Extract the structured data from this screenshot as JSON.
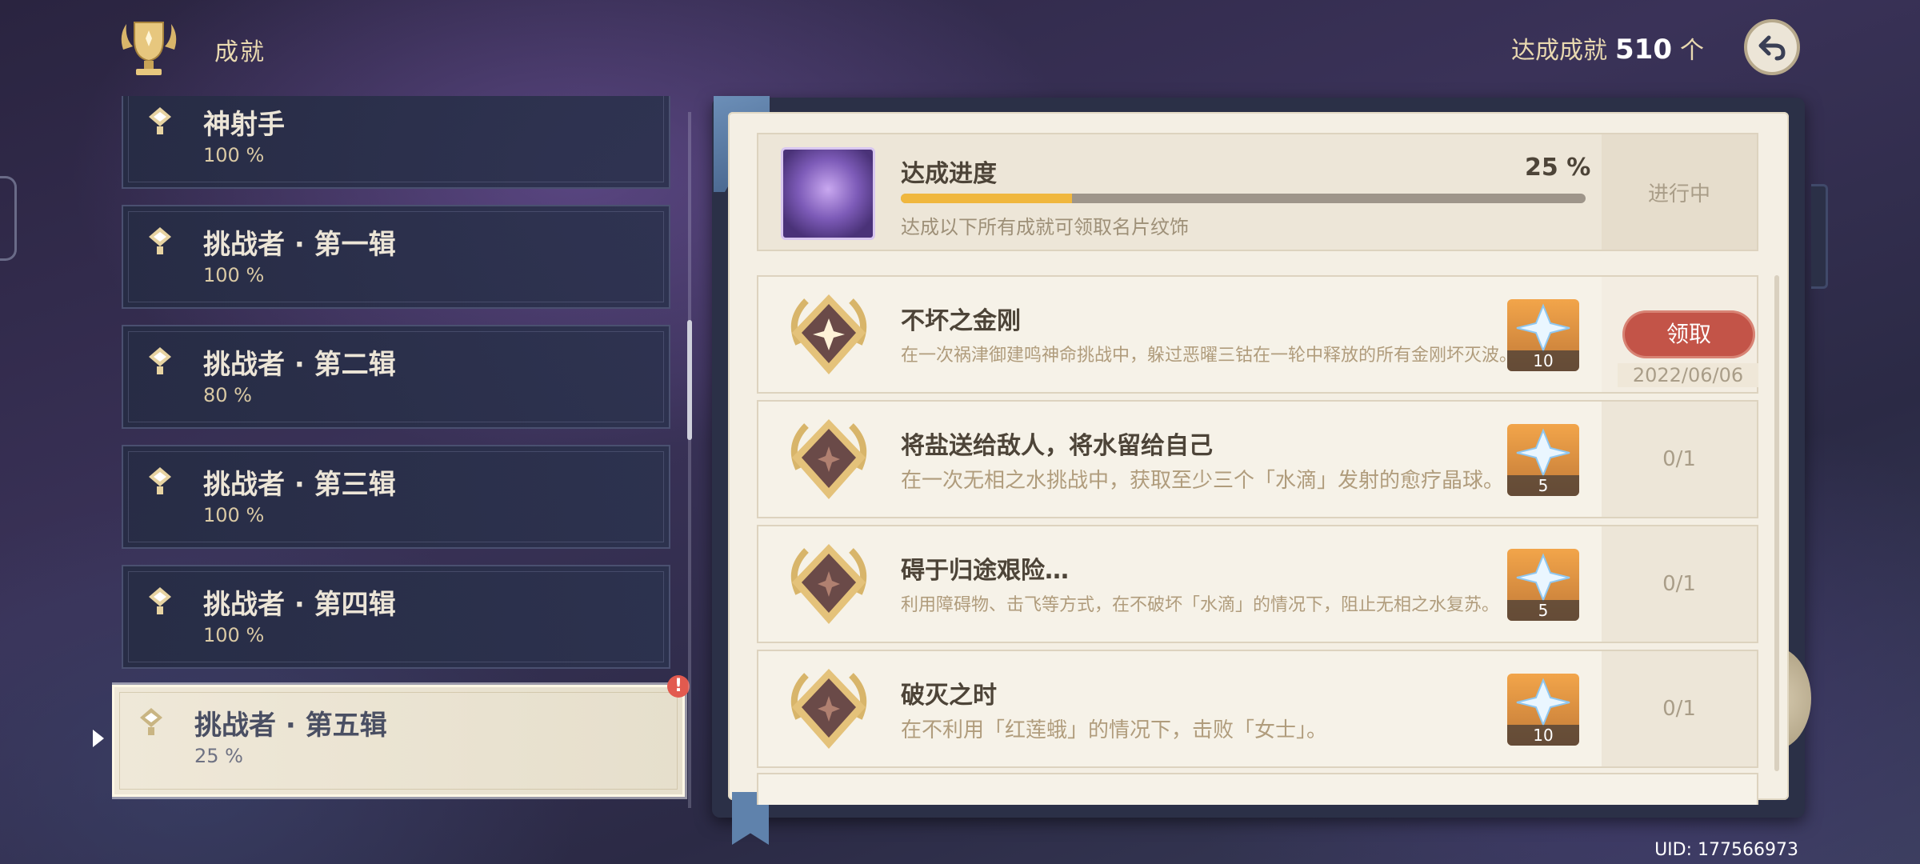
{
  "header": {
    "title": "成就",
    "achieved_label": "达成成就",
    "achieved_count": "510",
    "achieved_unit": "个"
  },
  "categories": [
    {
      "name": "神射手",
      "percent": "100 %"
    },
    {
      "name": "挑战者 · 第一辑",
      "percent": "100 %"
    },
    {
      "name": "挑战者 · 第二辑",
      "percent": "80 %"
    },
    {
      "name": "挑战者 · 第三辑",
      "percent": "100 %"
    },
    {
      "name": "挑战者 · 第四辑",
      "percent": "100 %"
    },
    {
      "name": "挑战者 · 第五辑",
      "percent": "25 %",
      "selected": true
    }
  ],
  "notification_badge": "!",
  "progress": {
    "title": "达成进度",
    "percent_text": "25 %",
    "percent_value": 25,
    "description": "达成以下所有成就可领取名片纹饰",
    "status": "进行中"
  },
  "achievements": [
    {
      "title": "不坏之金刚",
      "description": "在一次祸津御建鸣神命挑战中，躲过恶曜三钴在一轮中释放的所有金刚坏灭波。",
      "reward_count": "10",
      "claim_label": "领取",
      "date": "2022/06/06"
    },
    {
      "title": "将盐送给敌人，将水留给自己",
      "description": "在一次无相之水挑战中，获取至少三个「水滴」发射的愈疗晶球。",
      "reward_count": "5",
      "progress": "0/1"
    },
    {
      "title": "碍于归途艰险…",
      "description": "利用障碍物、击飞等方式，在不破坏「水滴」的情况下，阻止无相之水复苏。",
      "reward_count": "5",
      "progress": "0/1"
    },
    {
      "title": "破灭之时",
      "description": "在不利用「红莲蛾」的情况下，击败「女士」。",
      "reward_count": "10",
      "progress": "0/1"
    }
  ],
  "uid": "UID: 177566973",
  "colors": {
    "accent_gold": "#f0b73e",
    "claim_red": "#c35448",
    "page_bg": "#f4efe4",
    "panel_dark": "#2b3047"
  },
  "icons": [
    "trophy-icon",
    "back-icon",
    "category-icon",
    "achievement-badge-icon",
    "primogem-icon"
  ]
}
